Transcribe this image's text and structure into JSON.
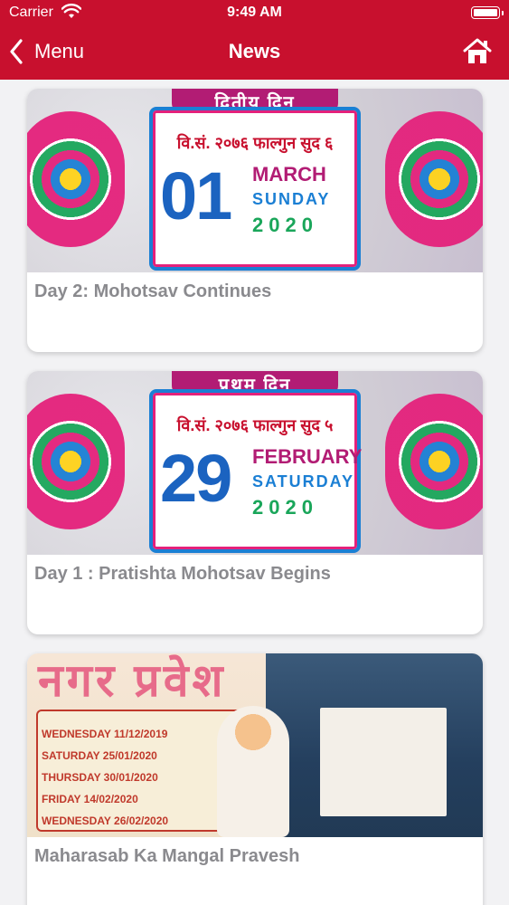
{
  "status_bar": {
    "carrier": "Carrier",
    "time": "9:49 AM"
  },
  "navbar": {
    "back_label": "Menu",
    "title": "News"
  },
  "colors": {
    "accent": "#c8102e",
    "card_title": "#8a8a8e"
  },
  "news": [
    {
      "title": "Day 2: Mohotsav Continues",
      "poster": {
        "tag": "द्वितीय दिन",
        "vikram": "वि.सं. २०७६ फाल्गुन सुद ६",
        "day": "01",
        "month": "MARCH",
        "weekday": "SUNDAY",
        "year": "2020"
      }
    },
    {
      "title": "Day 1 : Pratishta Mohotsav Begins",
      "poster": {
        "tag": "प्रथम दिन",
        "vikram": "वि.सं. २०७६ फाल्गुन सुद ५",
        "day": "29",
        "month": "FEBRUARY",
        "weekday": "SATURDAY",
        "year": "2020"
      }
    },
    {
      "title": "Maharasab Ka Mangal Pravesh",
      "poster": {
        "tag": "नगर प्रवेश",
        "lines": [
          "WEDNESDAY 11/12/2019",
          "SATURDAY 25/01/2020",
          "THURSDAY 30/01/2020",
          "FRIDAY 14/02/2020",
          "WEDNESDAY 26/02/2020"
        ]
      }
    }
  ]
}
